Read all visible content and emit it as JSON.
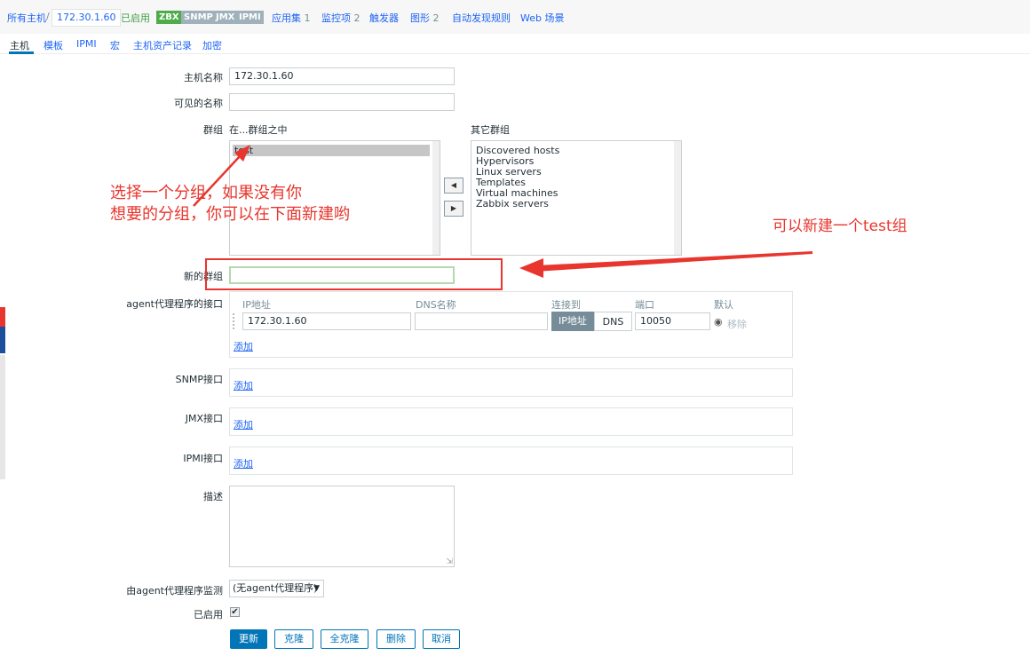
{
  "breadcrumb": {
    "all_hosts": "所有主机",
    "separator": "/",
    "host_ip": "172.30.1.60",
    "status": "已启用",
    "availability": [
      "ZBX",
      "SNMP",
      "JMX",
      "IPMI"
    ],
    "links": [
      {
        "label": "应用集",
        "count": "1"
      },
      {
        "label": "监控项",
        "count": "2"
      },
      {
        "label": "触发器",
        "count": ""
      },
      {
        "label": "图形",
        "count": "2"
      },
      {
        "label": "自动发现规则",
        "count": ""
      },
      {
        "label": "Web 场景",
        "count": ""
      }
    ]
  },
  "tabs": [
    "主机",
    "模板",
    "IPMI",
    "宏",
    "主机资产记录",
    "加密"
  ],
  "form": {
    "host_name_label": "主机名称",
    "host_name_value": "172.30.1.60",
    "visible_name_label": "可见的名称",
    "visible_name_value": "",
    "groups_label": "群组",
    "in_groups_label": "在...群组之中",
    "other_groups_label": "其它群组",
    "in_groups": [
      "test"
    ],
    "other_groups": [
      "Discovered hosts",
      "Hypervisors",
      "Linux servers",
      "Templates",
      "Virtual machines",
      "Zabbix servers"
    ],
    "new_group_label": "新的群组",
    "new_group_value": "",
    "agent_interfaces_label": "agent代理程序的接口",
    "interface_columns": {
      "ip": "IP地址",
      "dns": "DNS名称",
      "connect": "连接到",
      "port": "端口",
      "default": "默认"
    },
    "interface_ip": "172.30.1.60",
    "interface_dns": "",
    "connect_ip": "IP地址",
    "connect_dns": "DNS",
    "interface_port": "10050",
    "remove_label": "移除",
    "add_label": "添加",
    "snmp_label": "SNMP接口",
    "jmx_label": "JMX接口",
    "ipmi_label": "IPMI接口",
    "description_label": "描述",
    "proxy_label": "由agent代理程序监测",
    "proxy_value": "(无agent代理程序)",
    "enabled_label": "已启用",
    "enabled_checked": true
  },
  "buttons": {
    "update": "更新",
    "clone": "克隆",
    "full_clone": "全克隆",
    "delete": "删除",
    "cancel": "取消"
  },
  "annotations": {
    "left_line1": "选择一个分组，如果没有你",
    "left_line2": "想要的分组，你可以在下面新建哟",
    "right": "可以新建一个test组"
  },
  "colors": {
    "link": "#1f65f4",
    "primary": "#0275b8",
    "annotation": "#e8352d",
    "enabled": "#429e47"
  }
}
